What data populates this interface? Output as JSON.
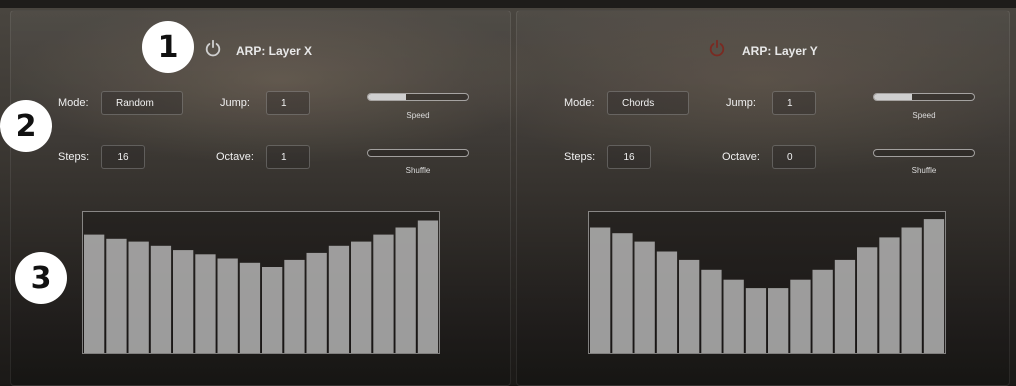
{
  "annotations": {
    "badge1": "1",
    "badge2": "2",
    "badge3": "3"
  },
  "layerX": {
    "title": "ARP: Layer X",
    "power_on": true,
    "mode_label": "Mode:",
    "mode_value": "Random",
    "jump_label": "Jump:",
    "jump_value": "1",
    "steps_label": "Steps:",
    "steps_value": "16",
    "octave_label": "Octave:",
    "octave_value": "1",
    "speed_label": "Speed",
    "speed_value": 0.38,
    "shuffle_label": "Shuffle",
    "shuffle_value": 0.0,
    "step_levels": [
      0.84,
      0.81,
      0.79,
      0.76,
      0.73,
      0.7,
      0.67,
      0.64,
      0.61,
      0.66,
      0.71,
      0.76,
      0.79,
      0.84,
      0.89,
      0.94
    ]
  },
  "layerY": {
    "title": "ARP: Layer Y",
    "power_on": false,
    "mode_label": "Mode:",
    "mode_value": "Chords",
    "jump_label": "Jump:",
    "jump_value": "1",
    "steps_label": "Steps:",
    "steps_value": "16",
    "octave_label": "Octave:",
    "octave_value": "0",
    "speed_label": "Speed",
    "speed_value": 0.38,
    "shuffle_label": "Shuffle",
    "shuffle_value": 0.0,
    "step_levels": [
      0.89,
      0.85,
      0.79,
      0.72,
      0.66,
      0.59,
      0.52,
      0.46,
      0.46,
      0.52,
      0.59,
      0.66,
      0.75,
      0.82,
      0.89,
      0.95
    ]
  },
  "colors": {
    "power_on": "#d0d0d0",
    "power_off": "#7a2a22",
    "bar": "#b9b9b9"
  }
}
